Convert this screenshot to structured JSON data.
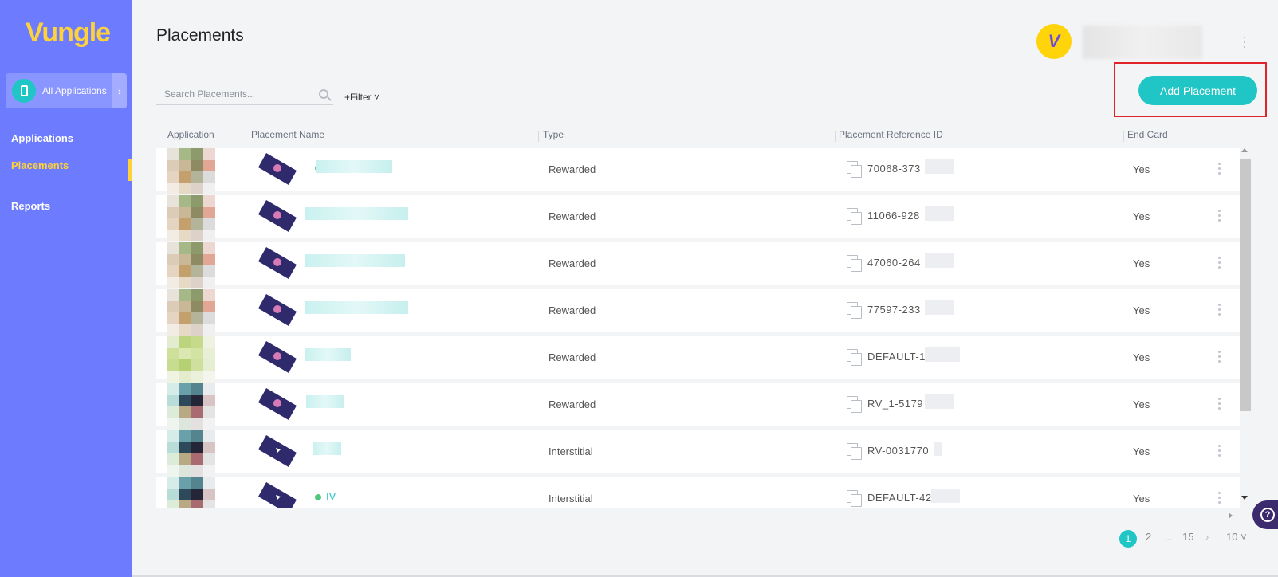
{
  "brand": {
    "name": "Vungle"
  },
  "sidebar": {
    "app_switcher_label": "All Applications",
    "items": [
      {
        "label": "Applications"
      },
      {
        "label": "Placements"
      },
      {
        "label": "Reports"
      }
    ]
  },
  "header": {
    "title": "Placements"
  },
  "toolbar": {
    "search_placeholder": "Search Placements...",
    "filter_label": "+Filter ˅",
    "add_button_label": "Add Placement"
  },
  "table": {
    "columns": [
      "Application",
      "Placement Name",
      "Type",
      "Placement Reference ID",
      "End Card"
    ],
    "rows": [
      {
        "type": "Rewarded",
        "ref_id": "70068-373",
        "end_card": "Yes"
      },
      {
        "type": "Rewarded",
        "ref_id": "11066-928",
        "end_card": "Yes"
      },
      {
        "type": "Rewarded",
        "ref_id": "47060-264",
        "end_card": "Yes"
      },
      {
        "type": "Rewarded",
        "ref_id": "77597-233",
        "end_card": "Yes"
      },
      {
        "type": "Rewarded",
        "ref_id": "DEFAULT-1",
        "end_card": "Yes"
      },
      {
        "type": "Rewarded",
        "ref_id": "RV_1-5179",
        "end_card": "Yes"
      },
      {
        "type": "Interstitial",
        "ref_id": "RV-0031770",
        "end_card": "Yes"
      },
      {
        "type": "Interstitial",
        "ref_id": "DEFAULT-42",
        "end_card": "Yes",
        "name": "IV"
      }
    ]
  },
  "pagination": {
    "pages": [
      "1",
      "2",
      "...",
      "15"
    ],
    "next": "›",
    "page_size": "10 ˅"
  },
  "colors": {
    "sidebar": "#6d7cff",
    "accent": "#20c6c5",
    "brand_yellow": "#ffd23a",
    "highlight_frame": "#e0242a"
  }
}
